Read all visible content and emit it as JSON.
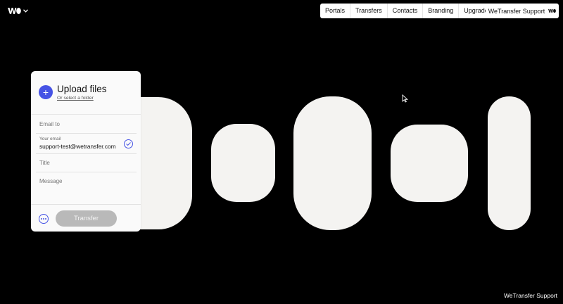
{
  "logo": {
    "icon": "wetransfer-logo-icon"
  },
  "topnav": {
    "items": [
      "Portals",
      "Transfers",
      "Contacts",
      "Branding",
      "Upgrade"
    ]
  },
  "support_button": {
    "label": "WeTransfer Support",
    "icon": "wetransfer-logo-icon"
  },
  "upload_panel": {
    "title": "Upload files",
    "select_folder": "Or select a folder",
    "email_to_placeholder": "Email to",
    "your_email_label": "Your email",
    "your_email_value": "support-test@wetransfer.com",
    "title_placeholder": "Title",
    "message_placeholder": "Message",
    "transfer_label": "Transfer"
  },
  "colors": {
    "accent": "#4653e5",
    "background": "#000000",
    "blob": "#f4f3f1",
    "button_disabled": "#b9b9b9"
  },
  "footer": {
    "support_link": "WeTransfer Support"
  }
}
